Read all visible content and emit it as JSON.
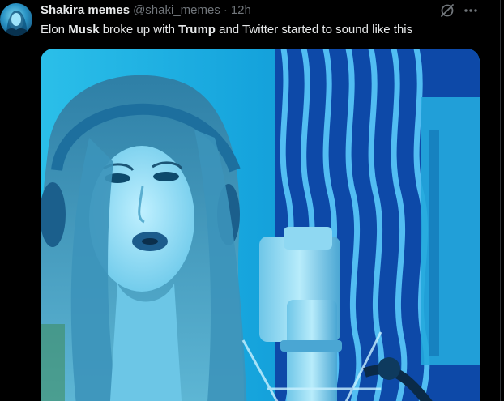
{
  "tweet": {
    "author": {
      "display_name": "Shakira memes",
      "handle": "@shaki_memes",
      "separator": "·",
      "time": "12h"
    },
    "text": {
      "part1": "Elon ",
      "bold1": "Musk",
      "part2": " broke up with ",
      "bold2": "Trump",
      "part3": " and Twitter started to sound like this"
    },
    "icons": {
      "avatar": "avatar-image",
      "grok": "grok-icon",
      "more": "more-icon"
    },
    "media": {
      "kind": "video",
      "description_icon": "video-thumbnail"
    }
  },
  "colors": {
    "background": "#000000",
    "text_primary": "#e7e9ea",
    "text_secondary": "#71767b",
    "media_tint": "#1aa3d6"
  }
}
